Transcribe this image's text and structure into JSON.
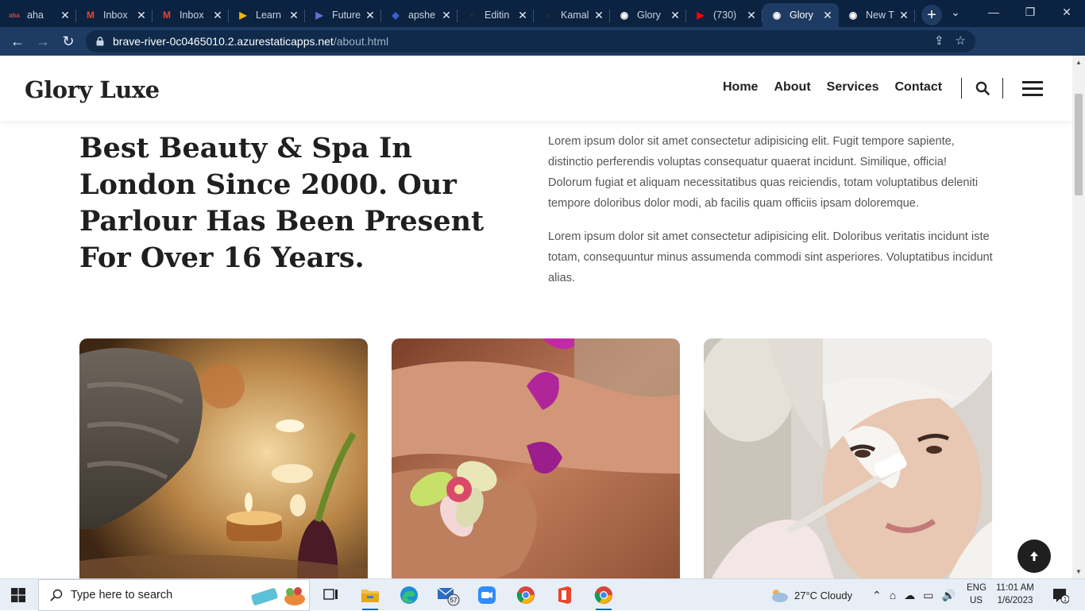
{
  "browser": {
    "tabs": [
      {
        "title": "aha",
        "favicon": "aha-icon",
        "favicon_color": "#e8412c",
        "close": "✕",
        "active": false
      },
      {
        "title": "Inbox",
        "favicon": "gmail-icon",
        "favicon_color": "#ea4335",
        "close": "✕",
        "active": false
      },
      {
        "title": "Inbox",
        "favicon": "gmail-icon",
        "favicon_color": "#ea4335",
        "close": "✕",
        "active": false
      },
      {
        "title": "Learn",
        "favicon": "play-icon",
        "favicon_color": "#f5b400",
        "close": "✕",
        "active": false
      },
      {
        "title": "Future",
        "favicon": "play-icon",
        "favicon_color": "#6b6bd6",
        "close": "✕",
        "active": false
      },
      {
        "title": "apshe",
        "favicon": "site-icon",
        "favicon_color": "#3a60d0",
        "close": "✕",
        "active": false
      },
      {
        "title": "Editin",
        "favicon": "github-icon",
        "favicon_color": "#1f2937",
        "close": "✕",
        "active": false
      },
      {
        "title": "Kamal",
        "favicon": "github-icon",
        "favicon_color": "#1f2937",
        "close": "✕",
        "active": false
      },
      {
        "title": "Glory",
        "favicon": "chrome-icon",
        "favicon_color": "#ffffff",
        "close": "✕",
        "active": false
      },
      {
        "title": "(730)",
        "favicon": "youtube-icon",
        "favicon_color": "#ff0000",
        "close": "✕",
        "active": false
      },
      {
        "title": "Glory",
        "favicon": "chrome-icon",
        "favicon_color": "#ffffff",
        "close": "✕",
        "active": true
      },
      {
        "title": "New T",
        "favicon": "chrome-icon",
        "favicon_color": "#ffffff",
        "close": "✕",
        "active": false
      }
    ],
    "new_tab": "+",
    "url_host": "brave-river-0c0465010.2.azurestaticapps.net",
    "url_path": "/about.html",
    "colors": {
      "tabbar": "#0b2240",
      "toolbar": "#1e3b63"
    }
  },
  "site": {
    "logo": "Glory Luxe",
    "nav": [
      "Home",
      "About",
      "Services",
      "Contact"
    ],
    "hero_title": "Best Beauty & Spa In London Since 2000. Our Parlour Has Been Present For Over 16 Years.",
    "paragraph_1": "Lorem ipsum dolor sit amet consectetur adipisicing elit. Fugit tempore sapiente, distinctio perferendis voluptas consequatur quaerat incidunt. Similique, officia! Dolorum fugiat et aliquam necessitatibus quas reiciendis, totam voluptatibus deleniti tempore doloribus dolor modi, ab facilis quam officiis ipsam doloremque.",
    "paragraph_2": "Lorem ipsum dolor sit amet consectetur adipisicing elit. Doloribus veritatis incidunt iste totam, consequuntur minus assumenda commodi sint asperiores. Voluptatibus incidunt alias.",
    "cards": [
      {
        "image": "spa-towel-candles-photo"
      },
      {
        "image": "feet-flower-spa-photo"
      },
      {
        "image": "facial-mask-treatment-photo"
      }
    ]
  },
  "taskbar": {
    "search_placeholder": "Type here to search",
    "weather": "27°C  Cloudy",
    "mail_badge": "57",
    "lang_top": "ENG",
    "lang_bottom": "US",
    "time": "11:01 AM",
    "date": "1/6/2023",
    "notification_badge": "1"
  }
}
